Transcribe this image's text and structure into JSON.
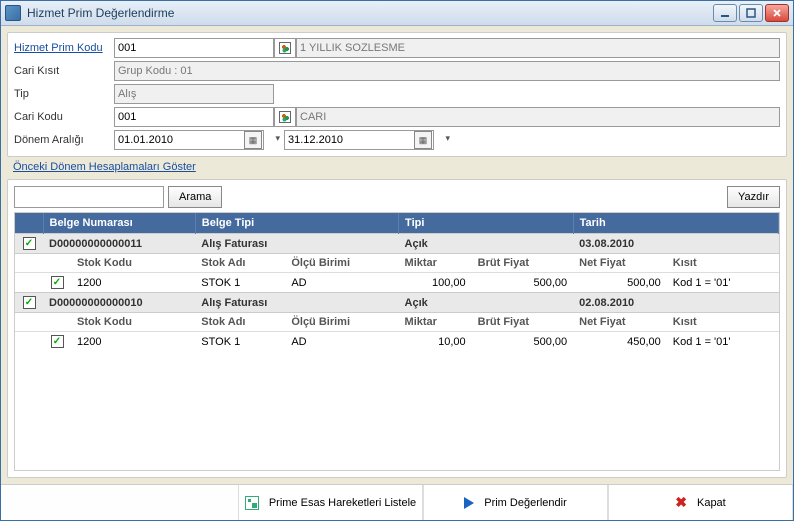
{
  "window": {
    "title": "Hizmet Prim Değerlendirme"
  },
  "form": {
    "label_hizmet_prim_kodu": "Hizmet Prim Kodu",
    "hizmet_prim_kodu": "001",
    "hizmet_prim_kodu_desc": "1 YILLIK SOZLESME",
    "label_cari_kisit": "Cari Kısıt",
    "cari_kisit": "Grup Kodu : 01",
    "label_tip": "Tip",
    "tip": "Alış",
    "label_cari_kodu": "Cari Kodu",
    "cari_kodu": "001",
    "cari_kodu_desc": "CARI",
    "label_donem": "Dönem Aralığı",
    "donem_start": "01.01.2010",
    "donem_end": "31.12.2010",
    "prev_link": "Önceki Dönem Hesaplamaları Göster"
  },
  "search": {
    "value": "",
    "placeholder": "",
    "btn": "Arama",
    "print": "Yazdır"
  },
  "headers": {
    "chk": "",
    "belge_no": "Belge Numarası",
    "belge_tipi": "Belge Tipi",
    "tipi": "Tipi",
    "tarih": "Tarih"
  },
  "subheaders": {
    "stok_kodu": "Stok Kodu",
    "stok_adi": "Stok Adı",
    "olcu": "Ölçü Birimi",
    "miktar": "Miktar",
    "brut": "Brüt Fiyat",
    "net": "Net Fiyat",
    "kisit": "Kısıt"
  },
  "groups": [
    {
      "checked": true,
      "belge_no": "D00000000000011",
      "belge_tipi": "Alış Faturası",
      "tipi": "Açık",
      "tarih": "03.08.2010",
      "lines": [
        {
          "checked": true,
          "stok_kodu": "1200",
          "stok_adi": "STOK 1",
          "olcu": "AD",
          "miktar": "100,00",
          "brut": "500,00",
          "net": "500,00",
          "kisit": "Kod 1 = '01'"
        }
      ]
    },
    {
      "checked": true,
      "belge_no": "D00000000000010",
      "belge_tipi": "Alış Faturası",
      "tipi": "Açık",
      "tarih": "02.08.2010",
      "lines": [
        {
          "checked": true,
          "stok_kodu": "1200",
          "stok_adi": "STOK 1",
          "olcu": "AD",
          "miktar": "10,00",
          "brut": "500,00",
          "net": "450,00",
          "kisit": "Kod 1 = '01'"
        }
      ]
    }
  ],
  "bottom": {
    "listele": "Prime Esas Hareketleri Listele",
    "degerlendir": "Prim Değerlendir",
    "kapat": "Kapat"
  }
}
